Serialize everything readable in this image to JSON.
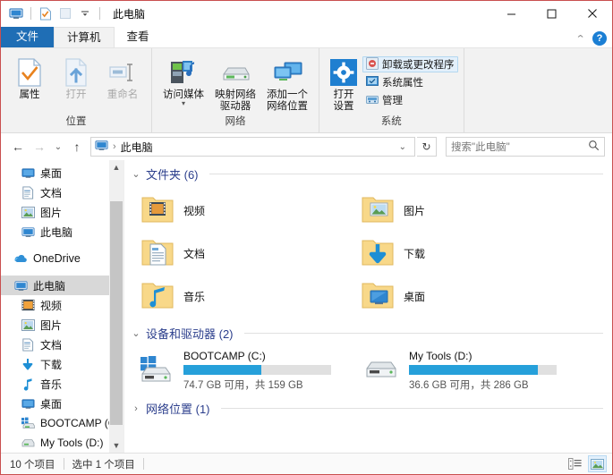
{
  "window": {
    "title": "此电脑",
    "quick_access": [
      "app-icon",
      "properties-icon",
      "new-folder-icon",
      "dropdown-caret"
    ],
    "controls": {
      "minimize": "—",
      "maximize": "☐",
      "close": "✕"
    }
  },
  "tabs": [
    {
      "label": "文件",
      "kind": "file"
    },
    {
      "label": "计算机",
      "kind": "active"
    },
    {
      "label": "查看",
      "kind": "normal"
    }
  ],
  "tabs_right": {
    "collapse": "⌃",
    "help": "?"
  },
  "ribbon": {
    "groups": [
      {
        "title": "位置",
        "buttons": [
          {
            "label": "属性",
            "icon": "properties-icon",
            "disabled": false,
            "caret": false
          },
          {
            "label": "打开",
            "icon": "open-icon",
            "disabled": true,
            "caret": false
          },
          {
            "label": "重命名",
            "icon": "rename-icon",
            "disabled": true,
            "caret": false
          }
        ]
      },
      {
        "title": "网络",
        "buttons": [
          {
            "label": "访问媒体",
            "icon": "media-server-icon",
            "disabled": false,
            "caret": true
          },
          {
            "label": "映射网络\n驱动器",
            "icon": "map-drive-icon",
            "disabled": false,
            "caret": true
          },
          {
            "label": "添加一个\n网络位置",
            "icon": "add-network-location-icon",
            "disabled": false,
            "caret": false
          }
        ]
      },
      {
        "title": "系统",
        "big_button": {
          "label": "打开\n设置",
          "icon": "settings-gear-icon"
        },
        "small_buttons": [
          {
            "label": "卸载或更改程序",
            "icon": "uninstall-icon",
            "hovered": true
          },
          {
            "label": "系统属性",
            "icon": "system-properties-icon",
            "hovered": false
          },
          {
            "label": "管理",
            "icon": "manage-icon",
            "hovered": false
          }
        ]
      }
    ]
  },
  "address": {
    "back": "←",
    "forward": "→",
    "recent": "⌄",
    "up": "↑",
    "crumb_icon": "this-pc-icon",
    "crumb_separator": "›",
    "crumb": "此电脑",
    "dropdown": "⌄",
    "refresh": "↻",
    "search_placeholder": "搜索\"此电脑\""
  },
  "nav_pane": {
    "items": [
      {
        "label": "桌面",
        "icon": "desktop-icon",
        "pinned": true,
        "selected": false
      },
      {
        "label": "文档",
        "icon": "documents-icon",
        "pinned": true,
        "selected": false
      },
      {
        "label": "图片",
        "icon": "pictures-icon",
        "pinned": true,
        "selected": false
      },
      {
        "label": "此电脑",
        "icon": "this-pc-icon",
        "pinned": true,
        "selected": false
      },
      {
        "label": "OneDrive",
        "icon": "onedrive-icon",
        "pinned": false,
        "selected": false,
        "spacer_before": true
      },
      {
        "label": "此电脑",
        "icon": "this-pc-icon",
        "pinned": false,
        "selected": true,
        "spacer_before": true
      },
      {
        "label": "视频",
        "icon": "videos-icon",
        "pinned": false,
        "selected": false
      },
      {
        "label": "图片",
        "icon": "pictures-icon",
        "pinned": false,
        "selected": false
      },
      {
        "label": "文档",
        "icon": "documents-icon",
        "pinned": false,
        "selected": false
      },
      {
        "label": "下载",
        "icon": "downloads-icon",
        "pinned": false,
        "selected": false
      },
      {
        "label": "音乐",
        "icon": "music-icon",
        "pinned": false,
        "selected": false
      },
      {
        "label": "桌面",
        "icon": "desktop-icon",
        "pinned": false,
        "selected": false
      },
      {
        "label": "BOOTCAMP (C",
        "icon": "windows-drive-icon",
        "pinned": false,
        "selected": false
      },
      {
        "label": "My Tools (D:)",
        "icon": "drive-icon",
        "pinned": false,
        "selected": false
      }
    ]
  },
  "content": {
    "folders_section": {
      "chevron": "⌄",
      "title": "文件夹 (6)"
    },
    "folders": [
      {
        "label": "视频",
        "icon": "folder-videos-icon"
      },
      {
        "label": "图片",
        "icon": "folder-pictures-icon"
      },
      {
        "label": "文档",
        "icon": "folder-documents-icon"
      },
      {
        "label": "下载",
        "icon": "folder-downloads-icon"
      },
      {
        "label": "音乐",
        "icon": "folder-music-icon"
      },
      {
        "label": "桌面",
        "icon": "folder-desktop-icon"
      }
    ],
    "drives_section": {
      "chevron": "⌄",
      "title": "设备和驱动器 (2)"
    },
    "drives": [
      {
        "name": "BOOTCAMP (C:)",
        "icon": "windows-drive-icon",
        "free_text": "74.7 GB 可用，共 159 GB",
        "free_gb": 74.7,
        "total_gb": 159,
        "used_percent": 53,
        "bar_color": "#26a0da"
      },
      {
        "name": "My Tools (D:)",
        "icon": "drive-icon",
        "free_text": "36.6 GB 可用，共 286 GB",
        "free_gb": 36.6,
        "total_gb": 286,
        "used_percent": 87,
        "bar_color": "#26a0da"
      }
    ],
    "network_section": {
      "chevron": "›",
      "title": "网络位置 (1)"
    }
  },
  "status": {
    "items_text": "10 个项目",
    "selection_text": "选中 1 个项目",
    "views": [
      {
        "name": "details-view",
        "active": false
      },
      {
        "name": "large-icons-view",
        "active": true
      }
    ]
  }
}
